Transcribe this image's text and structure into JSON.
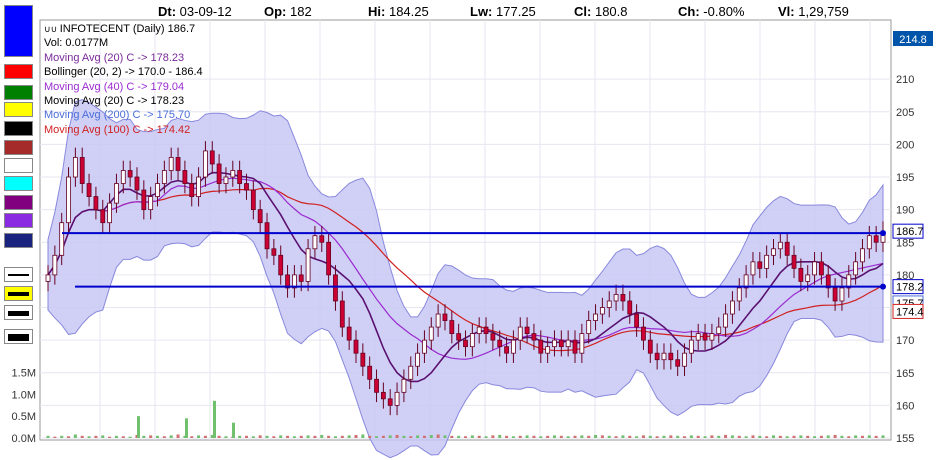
{
  "header": {
    "date_label": "Dt:",
    "date": "03-09-12",
    "open_label": "Op:",
    "open": "182",
    "high_label": "Hi:",
    "high": "184.25",
    "low_label": "Lw:",
    "low": "177.25",
    "close_label": "Cl:",
    "close": "180.8",
    "change_label": "Ch:",
    "change": "-0.80%",
    "volume_label": "Vl:",
    "volume": "1,29,759"
  },
  "legend": [
    {
      "text": "INFOTECENT (Daily) 186.7",
      "color": "#000000"
    },
    {
      "text": "Vol: 0.0177M",
      "color": "#000000"
    },
    {
      "text": "Moving Avg (20) C -> 178.23",
      "color": "#7a2a9a"
    },
    {
      "text": "Bollinger (20, 2) -> 170.0 - 186.4",
      "color": "#000000"
    },
    {
      "text": "Moving Avg (40) C -> 179.04",
      "color": "#9a2ad0"
    },
    {
      "text": "Moving Avg (20) C -> 178.23",
      "color": "#000000"
    },
    {
      "text": "Moving Avg (200) C -> 175.70",
      "color": "#4a6ed8"
    },
    {
      "text": "Moving Avg (100) C -> 174.42",
      "color": "#d02020"
    }
  ],
  "palette": {
    "colors": [
      "#0000ff",
      "#ff0000",
      "#008000",
      "#ffff00",
      "#000000",
      "#a52a2a",
      "#ffffff",
      "#00ffff",
      "#800080",
      "#8a2be2",
      "#1a237e"
    ],
    "line_styles": [
      "thin-line",
      "yellow-thick",
      "thick-line",
      "thicker-line"
    ]
  },
  "price_box": "214.8",
  "trendline_markers": [
    "186.7",
    "178.2",
    "175.7",
    "174.4"
  ],
  "chart_data": {
    "type": "candlestick",
    "title": "",
    "price_axis": {
      "ticks": [
        155,
        160,
        165,
        170,
        175,
        180,
        185,
        190,
        195,
        200,
        205,
        210
      ],
      "range": [
        155,
        216
      ]
    },
    "volume_axis": {
      "ticks": [
        "0.0M",
        "0.5M",
        "1.0M",
        "1.5M"
      ],
      "values": [
        0,
        0.5,
        1.0,
        1.5
      ]
    },
    "horizontal_lines": [
      {
        "value": 186.4,
        "color": "#0000cc"
      },
      {
        "value": 178.2,
        "color": "#0000cc"
      }
    ],
    "indicator_lines": [
      {
        "name": "Moving Avg (20) C",
        "color": "#6a1a8a",
        "value": 178.23
      },
      {
        "name": "Moving Avg (40) C",
        "color": "#9a2ad0",
        "value": 179.04
      },
      {
        "name": "Moving Avg (200) C",
        "color": "#4a6ed8",
        "value": 175.7
      },
      {
        "name": "Moving Avg (100) C",
        "color": "#d02020",
        "value": 174.42
      }
    ],
    "bollinger": {
      "upper": 186.4,
      "lower": 170.0
    },
    "last_close": 186.7,
    "price_marker": 214.8,
    "grid": true,
    "close_series": [
      180,
      183,
      188,
      195,
      198,
      194,
      192,
      190,
      188,
      191,
      194,
      196,
      195,
      193,
      190,
      192,
      194,
      196,
      198,
      196,
      194,
      192,
      195,
      199,
      197,
      194,
      195,
      196,
      194,
      193,
      190,
      188,
      184,
      183,
      180,
      178,
      180,
      179,
      184,
      186,
      185,
      180,
      176,
      172,
      170,
      168,
      166,
      164,
      162,
      161,
      160,
      162,
      164,
      166,
      168,
      170,
      172,
      174,
      173,
      171,
      170,
      169,
      171,
      172,
      171,
      170,
      169,
      168,
      170,
      172,
      171,
      170,
      168,
      169,
      170,
      169,
      170,
      168,
      171,
      173,
      174,
      175,
      176,
      177,
      176,
      174,
      172,
      170,
      168,
      167,
      168,
      167,
      166,
      168,
      170,
      171,
      170,
      171,
      172,
      174,
      176,
      178,
      180,
      182,
      181,
      183,
      184,
      185,
      183,
      181,
      179,
      180,
      182,
      180,
      178,
      176,
      178,
      180,
      182,
      184,
      186,
      185,
      186.7
    ],
    "volume_series": [
      0.05,
      0.03,
      0.05,
      0.04,
      0.08,
      0.05,
      0.04,
      0.05,
      0.06,
      0.03,
      0.05,
      0.04,
      0.03,
      0.07,
      0.05,
      0.06,
      0.05,
      0.04,
      0.06,
      0.08,
      0.05,
      0.04,
      0.06,
      0.05,
      0.07,
      0.05,
      0.04,
      0.03,
      0.05,
      0.05,
      0.04,
      0.06,
      0.05,
      0.04,
      0.06,
      0.05,
      0.04,
      0.05,
      0.06,
      0.05,
      0.07,
      0.05,
      0.04,
      0.05,
      0.06,
      0.07,
      0.08,
      0.05,
      0.04,
      0.05,
      0.06,
      0.07,
      0.05,
      0.04,
      0.06,
      0.05,
      0.07,
      0.08,
      0.06,
      0.05,
      0.05,
      0.04,
      0.06,
      0.05,
      0.04,
      0.06,
      0.07,
      0.05,
      0.04,
      0.05,
      0.06,
      0.05,
      0.04,
      0.05,
      0.06,
      0.05,
      0.04,
      0.05,
      0.06,
      0.05,
      0.07,
      0.06,
      0.05,
      0.04,
      0.06,
      0.05,
      0.04,
      0.06,
      0.05,
      0.04,
      0.05,
      0.06,
      0.05,
      0.04,
      0.06,
      0.05,
      0.04,
      0.06,
      0.05,
      0.07,
      0.06,
      0.05,
      0.04,
      0.06,
      0.05,
      0.04,
      0.06,
      0.05,
      0.04,
      0.05,
      0.06,
      0.05,
      0.04,
      0.05,
      0.06,
      0.07,
      0.05,
      0.04,
      0.06,
      0.05,
      0.06,
      0.05,
      0.06,
      0.05
    ]
  }
}
